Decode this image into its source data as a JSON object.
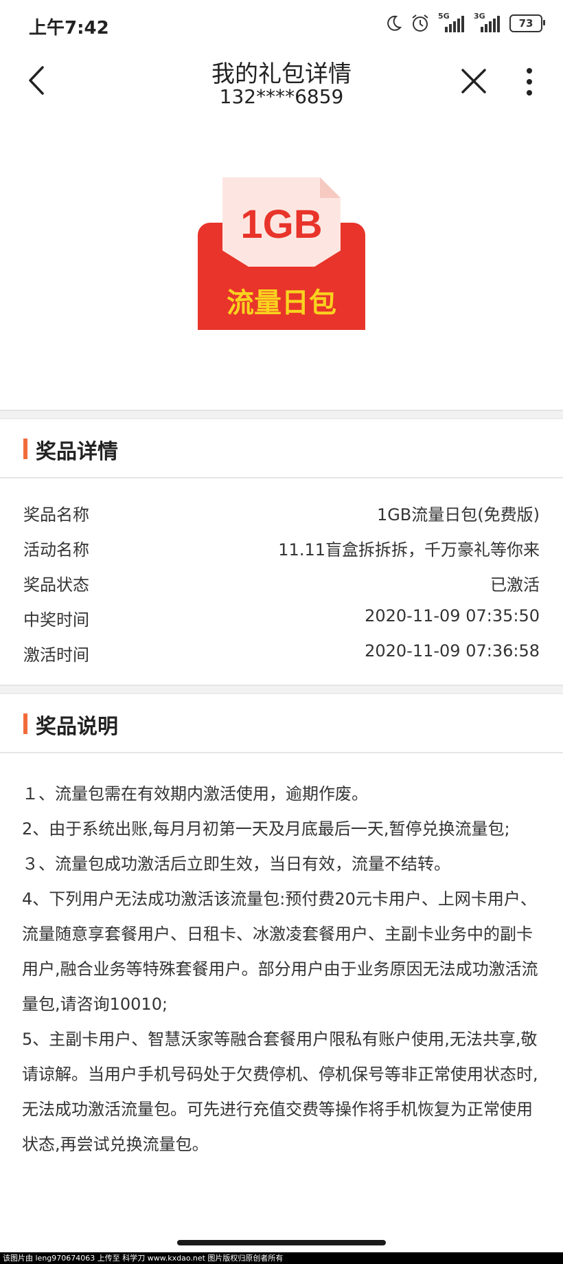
{
  "status_bar": {
    "time": "上午7:42",
    "network1": "5G",
    "network2": "3G",
    "battery": "73"
  },
  "header": {
    "title": "我的礼包详情",
    "subtitle": "132****6859"
  },
  "banner": {
    "amount": "1GB",
    "name": "流量日包",
    "accent_color": "#e8342a",
    "text_color": "#f9d31f"
  },
  "prize_details": {
    "heading": "奖品详情",
    "rows": [
      {
        "key": "奖品名称",
        "value": "1GB流量日包(免费版)"
      },
      {
        "key": "活动名称",
        "value": "11.11盲盒拆拆拆，千万豪礼等你来"
      },
      {
        "key": "奖品状态",
        "value": "已激活"
      },
      {
        "key": "中奖时间",
        "value": "2020-11-09 07:35:50"
      },
      {
        "key": "激活时间",
        "value": "2020-11-09 07:36:58"
      }
    ]
  },
  "prize_notes": {
    "heading": "奖品说明",
    "items": [
      "１、流量包需在有效期内激活使用，逾期作废。",
      "2、由于系统出账,每月月初第一天及月底最后一天,暂停兑换流量包;",
      "３、流量包成功激活后立即生效，当日有效，流量不结转。",
      "4、下列用户无法成功激活该流量包:预付费20元卡用户、上网卡用户、流量随意享套餐用户、日租卡、冰激凌套餐用户、主副卡业务中的副卡用户,融合业务等特殊套餐用户。部分用户由于业务原因无法成功激活流量包,请咨询10010;",
      "5、主副卡用户、智慧沃家等融合套餐用户限私有账户使用,无法共享,敬请谅解。当用户手机号码处于欠费停机、停机保号等非正常使用状态时,无法成功激活流量包。可先进行充值交费等操作将手机恢复为正常使用状态,再尝试兑换流量包。"
    ]
  },
  "watermark": "该图片由 leng970674063 上传至 科学刀 www.kxdao.net 图片版权归原创者所有"
}
